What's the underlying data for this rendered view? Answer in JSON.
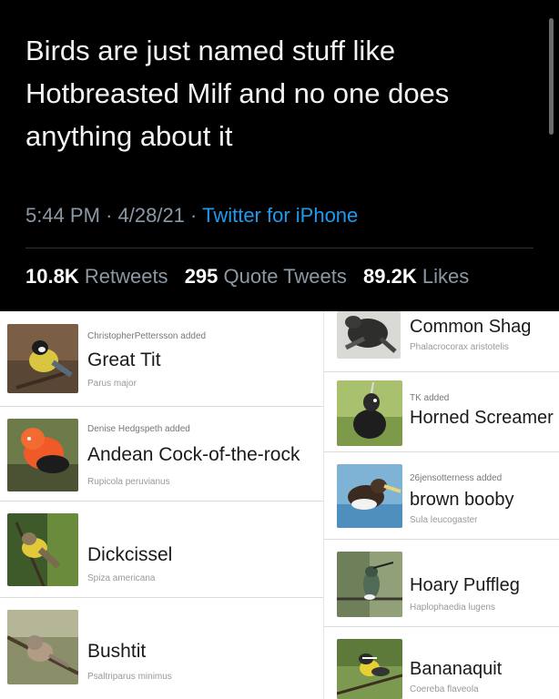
{
  "tweet": {
    "text": "Birds are just named stuff like Hotbreasted Milf and no one does anything about it",
    "time": "5:44 PM",
    "date": "4/28/21",
    "separator": "·",
    "source": "Twitter for iPhone",
    "retweets_count": "10.8K",
    "retweets_label": "Retweets",
    "quotes_count": "295",
    "quotes_label": "Quote Tweets",
    "likes_count": "89.2K",
    "likes_label": "Likes"
  },
  "left_cards": [
    {
      "added": "ChristopherPettersson added",
      "name": "Great Tit",
      "sci": "Parus major"
    },
    {
      "added": "Denise Hedgspeth added",
      "name": "Andean Cock-of-the-rock",
      "sci": "Rupicola peruvianus"
    },
    {
      "added": "",
      "name": "Dickcissel",
      "sci": "Spiza americana"
    },
    {
      "added": "",
      "name": "Bushtit",
      "sci": "Psaltriparus minimus"
    }
  ],
  "right_cards": [
    {
      "added": "",
      "name": "Common Shag",
      "sci": "Phalacrocorax aristotelis"
    },
    {
      "added": "TK added",
      "name": "Horned Screamer",
      "sci": ""
    },
    {
      "added": "26jensotterness added",
      "name": "brown booby",
      "sci": "Sula leucogaster"
    },
    {
      "added": "",
      "name": "Hoary Puffleg",
      "sci": "Haplophaedia lugens"
    },
    {
      "added": "",
      "name": "Bananaquit",
      "sci": "Coereba flaveola"
    }
  ],
  "colors": {
    "background": "#000000",
    "link": "#1d9bf0",
    "muted": "#8b98a5"
  }
}
